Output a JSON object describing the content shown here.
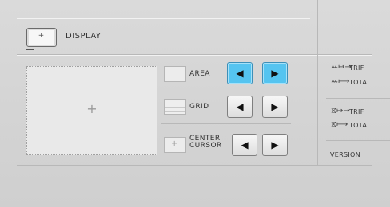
{
  "display": {
    "label": "DISPLAY",
    "button_icon": "plus",
    "icon": "display-icon"
  },
  "preview": {
    "cursor_icon": "plus-cursor-icon",
    "cursor": "+"
  },
  "settings": {
    "area": {
      "label": "AREA",
      "left_state": "active",
      "right_state": "active"
    },
    "grid": {
      "label": "GRID",
      "left_state": "normal",
      "right_state": "normal"
    },
    "center_cursor": {
      "label_line1": "CENTER",
      "label_line2": "CURSOR",
      "left_state": "normal",
      "right_state": "normal"
    }
  },
  "arrows": {
    "left": "◀",
    "right": "▶"
  },
  "stats": {
    "trip1_label": "TRIF",
    "total1_label": "TOTA",
    "trip2_label": "TRIF",
    "total2_label": "TOTA",
    "trip1_icon": "ꕀ↦→",
    "total1_icon": "ꕀ⟼",
    "trip2_icon": "⧖↦→",
    "total2_icon": "⧖⟼"
  },
  "version": {
    "label": "VERSION"
  },
  "colors": {
    "accent": "#55c4f0",
    "background": "#d4d4d4"
  }
}
